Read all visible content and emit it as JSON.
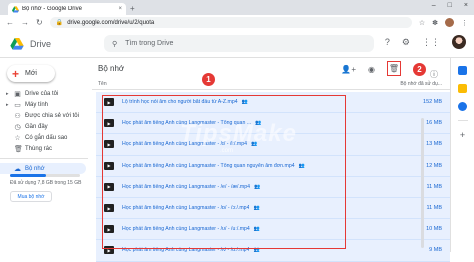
{
  "browser": {
    "tab_title": "Bộ nhớ - Google Drive",
    "tab_close": "×",
    "new_tab": "+",
    "url": "drive.google.com/drive/u/2/quota",
    "window_controls": [
      "–",
      "□",
      "×"
    ]
  },
  "app": {
    "brand": "Drive",
    "search_placeholder": "Tìm trong Drive"
  },
  "sidebar": {
    "new_label": "Mới",
    "items": [
      {
        "label": "Drive của tôi",
        "icon": "drive-icon",
        "expandable": true
      },
      {
        "label": "Máy tính",
        "icon": "computer-icon",
        "expandable": true
      },
      {
        "label": "Được chia sẻ với tôi",
        "icon": "shared-icon",
        "expandable": false
      },
      {
        "label": "Gần đây",
        "icon": "clock-icon",
        "expandable": false
      },
      {
        "label": "Có gắn dấu sao",
        "icon": "star-icon",
        "expandable": false
      },
      {
        "label": "Thùng rác",
        "icon": "trash-icon",
        "expandable": false
      }
    ],
    "storage_label": "Bộ nhớ",
    "storage_text": "Đã sử dụng 7,8 GB trong 15 GB",
    "storage_used_fraction": 0.52,
    "buy_label": "Mua bộ nhớ"
  },
  "main": {
    "title": "Bộ nhớ",
    "header_name": "Tên",
    "header_size": "Bộ nhớ đã sử dụ...",
    "files": [
      {
        "name": "Lộ trình học nói âm cho người bắt đầu từ A-Z.mp4",
        "size": "152 MB"
      },
      {
        "name": "Học phát âm tiếng Anh cùng Langmaster - Tổng quan ...",
        "size": "16 MB"
      },
      {
        "name": "Học phát âm tiếng Anh cùng Langmaster - /ɪ/ - /iː/.mp4",
        "size": "13 MB"
      },
      {
        "name": "Học phát âm tiếng Anh cùng Langmaster - Tổng quan nguyên âm đơn.mp4",
        "size": "12 MB"
      },
      {
        "name": "Học phát âm tiếng Anh cùng Langmaster - /e/ - /æ/.mp4",
        "size": "11 MB"
      },
      {
        "name": "Học phát âm tiếng Anh cùng Langmaster - /ɒ/ - /ɔː/.mp4",
        "size": "11 MB"
      },
      {
        "name": "Học phát âm tiếng Anh cùng Langmaster - /ʊ/ - /uː/.mp4",
        "size": "10 MB"
      },
      {
        "name": "Học phát âm tiếng Anh cùng Langmaster - /ʌ/ - /ɑː/.mp4",
        "size": "9 MB"
      }
    ],
    "annotation_1": "1",
    "annotation_2": "2",
    "watermark": "TipsMake",
    "watermark_sub": ".com"
  },
  "colors": {
    "accent": "#1a73e8",
    "selection": "#e8f0fe",
    "annotation": "#e53935"
  }
}
